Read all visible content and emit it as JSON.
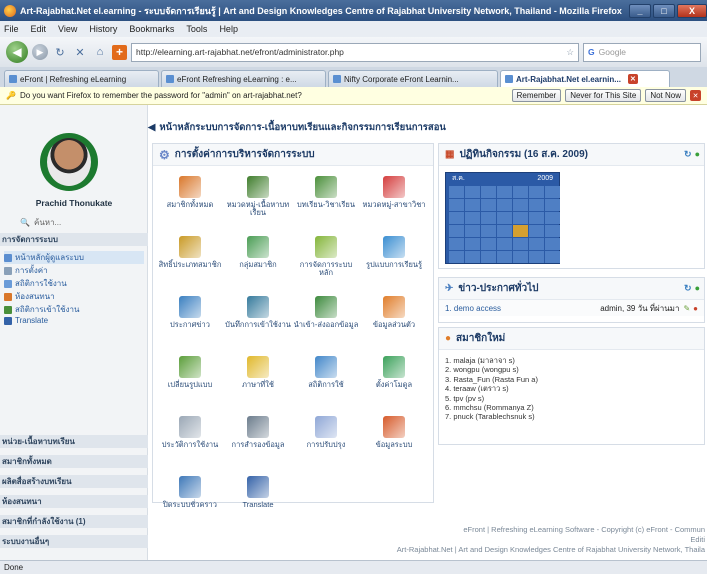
{
  "window": {
    "title": "Art-Rajabhat.Net el.earning - ระบบจัดการเรียนรู้ | Art and Design Knowledges Centre of Rajabhat University Network, Thailand - Mozilla Firefox",
    "controls": [
      "_",
      "□",
      "X"
    ]
  },
  "menu": [
    "File",
    "Edit",
    "View",
    "History",
    "Bookmarks",
    "Tools",
    "Help"
  ],
  "nav": {
    "url": "http://elearning.art-rajabhat.net/efront/administrator.php",
    "search_placeholder": "Google"
  },
  "tabs": [
    {
      "label": "eFront | Refreshing eLearning"
    },
    {
      "label": "eFront Refreshing eLearning : e..."
    },
    {
      "label": "Nifty Corporate eFront Learnin..."
    },
    {
      "label": "Art-Rajabhat.Net el.earnin...",
      "active": true
    }
  ],
  "password_bar": {
    "message": "Do you want Firefox to remember the password for \"admin\" on art-rajabhat.net?",
    "remember": "Remember",
    "never": "Never for This Site",
    "not_now": "Not Now"
  },
  "sidebar": {
    "username": "Prachid Thonukate",
    "search_label": "ค้นหา...",
    "section_admin": "การจัดการระบบ",
    "admin_links": [
      {
        "label": "หน้าหลักผู้ดูแลระบบ",
        "selected": true
      },
      {
        "label": "การตั้งค่า"
      },
      {
        "label": "สถิติการใช้งาน"
      },
      {
        "label": "ห้องสนทนา"
      },
      {
        "label": "สถิติการเข้าใช้งาน"
      },
      {
        "label": "Translate"
      }
    ],
    "bottom_sections": [
      "หน่วย-เนื้อหาบทเรียน",
      "สมาชิกทั้งหมด",
      "ผลิตสื่อสร้างบทเรียน",
      "ห้องสนทนา",
      "สมาชิกที่กำลังใช้งาน (1)",
      "ระบบงานอื่นๆ"
    ]
  },
  "breadcrumb": {
    "arrow": "◀",
    "text": "หน้าหลักระบบการจัดการ-เนื้อหาบทเรียนและกิจกรรมการเรียนการสอน"
  },
  "admin_panel": {
    "title": "การตั้งค่าการบริหารจัดการระบบ",
    "items": [
      {
        "label": "สมาชิกทั้งหมด",
        "color": "#d9772b"
      },
      {
        "label": "หมวดหมู่-เนื้อหาบทเรียน",
        "color": "#3f7d2c"
      },
      {
        "label": "บทเรียน-วิชาเรียน",
        "color": "#4a8f3a"
      },
      {
        "label": "หมวดหมู่-สาขาวิชา",
        "color": "#d43d3d"
      },
      {
        "label": "สิทธิ์ประเภทสมาชิก",
        "color": "#c99a26"
      },
      {
        "label": "กลุ่มสมาชิก",
        "color": "#4a9d54"
      },
      {
        "label": "การจัดการระบบหลัก",
        "color": "#84b53a"
      },
      {
        "label": "รูปแบบการเรียนรู้",
        "color": "#3a8ed1"
      },
      {
        "label": "ประกาศข่าว",
        "color": "#3a7fc0"
      },
      {
        "label": "บันทึกการเข้าใช้งาน",
        "color": "#357a9c"
      },
      {
        "label": "นำเข้า-ส่งออกข้อมูล",
        "color": "#3d8a3d"
      },
      {
        "label": "ข้อมูลส่วนตัว",
        "color": "#e07d2a"
      },
      {
        "label": "เปลี่ยนรูปแบบ",
        "color": "#5b9e3a"
      },
      {
        "label": "ภาษาที่ใช้",
        "color": "#e0b82b"
      },
      {
        "label": "สถิติการใช้",
        "color": "#4287c9"
      },
      {
        "label": "ตั้งค่าโมดูล",
        "color": "#3ba15a"
      },
      {
        "label": "ประวัติการใช้งาน",
        "color": "#9aa7b5"
      },
      {
        "label": "การสำรองข้อมูล",
        "color": "#6b7c8c"
      },
      {
        "label": "การปรับปรุง",
        "color": "#8fa7d6"
      },
      {
        "label": "ข้อมูลระบบ",
        "color": "#d65a2a"
      },
      {
        "label": "ปิดระบบชั่วคราว",
        "color": "#3e78b8"
      },
      {
        "label": "Translate",
        "color": "#3462a8"
      }
    ]
  },
  "calendar_panel": {
    "title": "ปฏิทินกิจกรรม (16 ส.ค. 2009)",
    "month_label": "ส.ค.",
    "year_label": "2009"
  },
  "news_panel": {
    "title": "ข่าว-ประกาศทั่วไป",
    "item_title": "1. demo access",
    "item_meta": "admin, 39 วัน ที่ผ่านมา"
  },
  "members_panel": {
    "title": "สมาชิกใหม่",
    "members": [
      "1. malaja (มาลาจา s)",
      "2. wongpu (wongpu s)",
      "3. Rasta_Fun (Rasta Fun a)",
      "4. teraaw (เตราว s)",
      "5. tpv (pv s)",
      "6. mmchsu (Rommanya Z)",
      "7. pnuck (Tarablechsnuk s)"
    ]
  },
  "footer": {
    "line1": "eFront | Refreshing eLearning Software - Copyright (c) eFront - Commun",
    "line2": "Editi",
    "line3": "Art-Rajabhat.Net | Art and Design Knowledges Centre of Rajabhat University Network, Thaila"
  },
  "status": {
    "text": "Done"
  }
}
